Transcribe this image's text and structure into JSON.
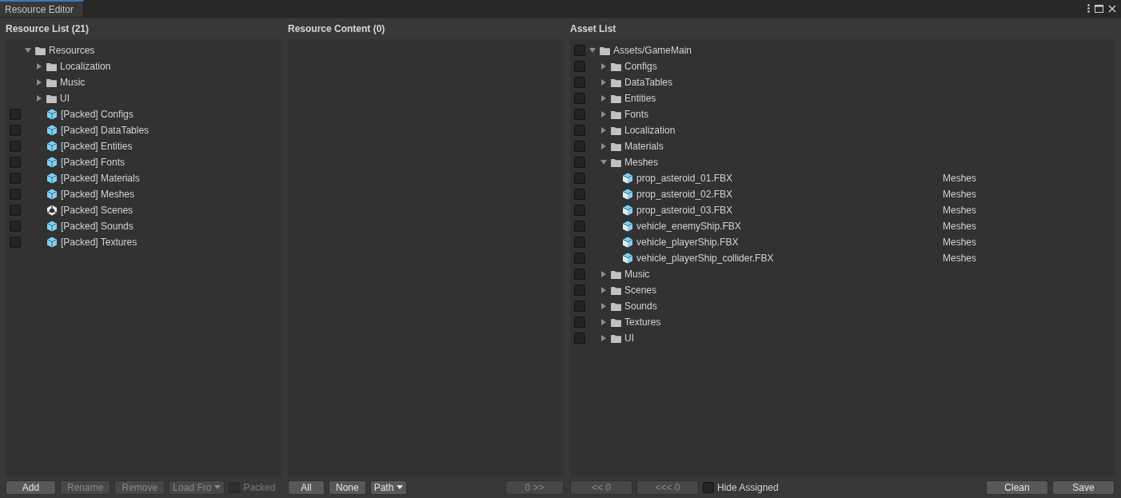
{
  "window": {
    "tab": {
      "title": "Resource Editor",
      "selected": true
    }
  },
  "panels": [
    {
      "title": "Resource List (21)",
      "tree": [
        {
          "label": "Resources",
          "kind": "folder",
          "expanded": true,
          "children": [
            {
              "label": "Localization",
              "kind": "folder",
              "expanded": false
            },
            {
              "label": "Music",
              "kind": "folder",
              "expanded": false
            },
            {
              "label": "UI",
              "kind": "folder",
              "expanded": false
            },
            {
              "label": "[Packed] Configs",
              "kind": "asset",
              "checked": false
            },
            {
              "label": "[Packed] DataTables",
              "kind": "asset",
              "checked": false
            },
            {
              "label": "[Packed] Entities",
              "kind": "asset",
              "checked": false
            },
            {
              "label": "[Packed] Fonts",
              "kind": "asset",
              "checked": false
            },
            {
              "label": "[Packed] Materials",
              "kind": "asset",
              "checked": false
            },
            {
              "label": "[Packed] Meshes",
              "kind": "asset",
              "checked": false
            },
            {
              "label": "[Packed] Scenes",
              "kind": "scene",
              "checked": false
            },
            {
              "label": "[Packed] Sounds",
              "kind": "asset",
              "checked": false
            },
            {
              "label": "[Packed] Textures",
              "kind": "asset",
              "checked": false
            }
          ]
        }
      ],
      "footer_left": [
        {
          "kind": "button",
          "label": "Add",
          "disabled": false
        },
        {
          "kind": "button",
          "label": "Rename",
          "disabled": true
        },
        {
          "kind": "button",
          "label": "Remove",
          "disabled": true
        },
        {
          "kind": "dropdown",
          "label": "Load Fro",
          "disabled": true
        },
        {
          "kind": "checkbox",
          "label": "Packed",
          "checked": false,
          "disabled": true
        }
      ]
    },
    {
      "title": "Resource Content (0)",
      "footer_left": [
        {
          "kind": "button",
          "label": "All",
          "disabled": false
        },
        {
          "kind": "button",
          "label": "None",
          "disabled": false
        },
        {
          "kind": "dropdown",
          "label": "Path",
          "disabled": false
        }
      ],
      "footer_right": [
        {
          "kind": "button",
          "label": "0 >>",
          "disabled": true
        }
      ]
    },
    {
      "title": "Asset List",
      "tree": [
        {
          "label": "Assets/GameMain",
          "kind": "folder",
          "expanded": true,
          "checked": false,
          "children": [
            {
              "label": "Configs",
              "kind": "folder",
              "expanded": false,
              "checked": false
            },
            {
              "label": "DataTables",
              "kind": "folder",
              "expanded": false,
              "checked": false
            },
            {
              "label": "Entities",
              "kind": "folder",
              "expanded": false,
              "checked": false
            },
            {
              "label": "Fonts",
              "kind": "folder",
              "expanded": false,
              "checked": false
            },
            {
              "label": "Localization",
              "kind": "folder",
              "expanded": false,
              "checked": false
            },
            {
              "label": "Materials",
              "kind": "folder",
              "expanded": false,
              "checked": false
            },
            {
              "label": "Meshes",
              "kind": "folder",
              "expanded": true,
              "checked": false,
              "children": [
                {
                  "label": "prop_asteroid_01.FBX",
                  "kind": "model",
                  "checked": false,
                  "resource": "Meshes"
                },
                {
                  "label": "prop_asteroid_02.FBX",
                  "kind": "model",
                  "checked": false,
                  "resource": "Meshes"
                },
                {
                  "label": "prop_asteroid_03.FBX",
                  "kind": "model",
                  "checked": false,
                  "resource": "Meshes"
                },
                {
                  "label": "vehicle_enemyShip.FBX",
                  "kind": "model",
                  "checked": false,
                  "resource": "Meshes"
                },
                {
                  "label": "vehicle_playerShip.FBX",
                  "kind": "model",
                  "checked": false,
                  "resource": "Meshes"
                },
                {
                  "label": "vehicle_playerShip_collider.FBX",
                  "kind": "model",
                  "checked": false,
                  "resource": "Meshes"
                }
              ]
            },
            {
              "label": "Music",
              "kind": "folder",
              "expanded": false,
              "checked": false
            },
            {
              "label": "Scenes",
              "kind": "folder",
              "expanded": false,
              "checked": false
            },
            {
              "label": "Sounds",
              "kind": "folder",
              "expanded": false,
              "checked": false
            },
            {
              "label": "Textures",
              "kind": "folder",
              "expanded": false,
              "checked": false
            },
            {
              "label": "UI",
              "kind": "folder",
              "expanded": false,
              "checked": false
            }
          ]
        }
      ],
      "footer_left": [
        {
          "kind": "button",
          "label": "<< 0",
          "disabled": true
        },
        {
          "kind": "button",
          "label": "<<< 0",
          "disabled": true
        },
        {
          "kind": "checkbox",
          "label": "Hide Assigned",
          "checked": false,
          "disabled": false
        }
      ],
      "footer_right": [
        {
          "kind": "button",
          "label": "Clean",
          "disabled": false
        },
        {
          "kind": "button",
          "label": "Save",
          "disabled": false
        }
      ]
    }
  ]
}
